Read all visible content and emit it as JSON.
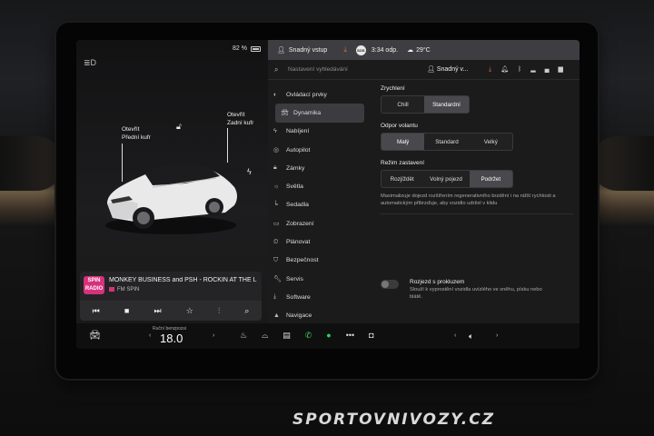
{
  "status_bar": {
    "battery": "82 %",
    "profile": "Snadný vstup",
    "sos": "SOS",
    "time": "3:34 odp.",
    "weather": "29°C"
  },
  "car": {
    "frunk_line1": "Otevřít",
    "frunk_line2": "Přední kufr",
    "trunk_line1": "Otevřít",
    "trunk_line2": "Zadní kufr"
  },
  "media": {
    "logo_line1": "SPIN",
    "logo_line2": "RADIO",
    "song": "MONKEY BUSINESS and PSH - ROCKIN AT THE L",
    "station": "FM SPIN"
  },
  "search": {
    "placeholder": "Nastavení vyhledávání",
    "profile": "Snadný v..."
  },
  "menu": [
    {
      "label": "Ovládací prvky",
      "icon": "toggle-icon"
    },
    {
      "label": "Dynamika",
      "icon": "car-icon",
      "active": true
    },
    {
      "label": "Nabíjení",
      "icon": "bolt-icon"
    },
    {
      "label": "Autopilot",
      "icon": "steering-wheel-icon"
    },
    {
      "label": "Zámky",
      "icon": "lock-icon"
    },
    {
      "label": "Světla",
      "icon": "sun-icon"
    },
    {
      "label": "Sedadla",
      "icon": "seat-icon"
    },
    {
      "label": "Zobrazení",
      "icon": "display-icon"
    },
    {
      "label": "Plánovat",
      "icon": "clock-icon"
    },
    {
      "label": "Bezpečnost",
      "icon": "shield-icon"
    },
    {
      "label": "Servis",
      "icon": "wrench-icon"
    },
    {
      "label": "Software",
      "icon": "download-icon"
    },
    {
      "label": "Navigace",
      "icon": "navigation-icon"
    }
  ],
  "acceleration": {
    "title": "Zrychlení",
    "options": [
      "Chill",
      "Standardní"
    ],
    "selected": "Standardní"
  },
  "steering": {
    "title": "Odpor volantu",
    "options": [
      "Malý",
      "Standard",
      "Velký"
    ],
    "selected": "Malý"
  },
  "stopping": {
    "title": "Režim zastavení",
    "options": [
      "Rozjíždět",
      "Volný pojezd",
      "Podržet"
    ],
    "selected": "Podržet",
    "description": "Maximalizuje dojezd rozšířením regenerativního brzdění i na nižší rychlosti a automatickým přibrzďuje, aby vozidlo udržel v klidu"
  },
  "slip_start": {
    "title": "Rozjezd s prokluzem",
    "description": "Slouží k vyprostění vozidla uvízlého ve sněhu, písku nebo blátě."
  },
  "climate": {
    "label": "Ruční benzpozsi",
    "temperature": "18.0"
  },
  "watermark": "SPORTOVNIVOZY.CZ"
}
